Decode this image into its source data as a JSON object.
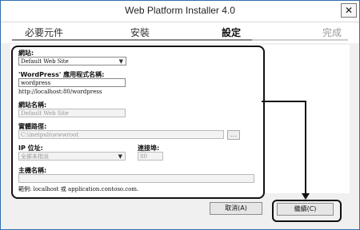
{
  "window": {
    "title": "Web Platform Installer 4.0",
    "close_glyph": "✕"
  },
  "steps": [
    {
      "label": "必要元件",
      "state": "done"
    },
    {
      "label": "安裝",
      "state": "done"
    },
    {
      "label": "設定",
      "state": "current"
    },
    {
      "label": "完成",
      "state": "pending"
    }
  ],
  "form": {
    "site": {
      "label": "網站:",
      "value": "Default Web Site"
    },
    "app_name": {
      "label": "'WordPress' 應用程式名稱:",
      "value": "wordpress",
      "url_note": "http://localhost:80/wordpress"
    },
    "site_name": {
      "label": "網站名稱:",
      "value": "Default Web Site"
    },
    "physical_path": {
      "label": "實體路徑:",
      "value": "C:\\inetpub\\wwwroot",
      "browse_label": "..."
    },
    "ip": {
      "label": "IP 位址:",
      "value": "全部未指派"
    },
    "port": {
      "label": "連接埠:",
      "value": "80"
    },
    "host": {
      "label": "主機名稱:",
      "value": ""
    },
    "example": "範例: localhost 或 application.contoso.com."
  },
  "buttons": {
    "cancel": "取消(A)",
    "continue": "繼續(C)"
  }
}
